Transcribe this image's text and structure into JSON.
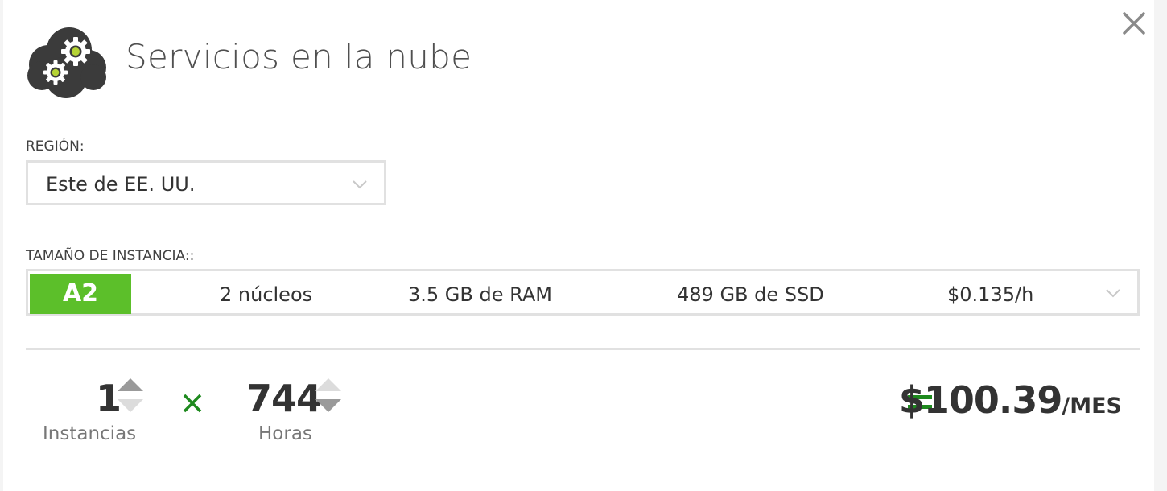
{
  "header": {
    "title": "Servicios en la nube",
    "logo_icon": "cloud-gears-icon",
    "close_icon": "close-icon"
  },
  "region": {
    "label": "REGIÓN:",
    "selected": "Este de EE. UU."
  },
  "instance_size": {
    "label": "TAMAÑO DE INSTANCIA::",
    "selected": {
      "tier": "A2",
      "cores": "2 núcleos",
      "ram": "3.5 GB de RAM",
      "storage": "489 GB de SSD",
      "price": "$0.135/h"
    }
  },
  "calculator": {
    "instances": {
      "value": "1",
      "label": "Instancias"
    },
    "hours": {
      "value": "744",
      "label": "Horas"
    },
    "total": {
      "amount": "$100.39",
      "unit": "/MES"
    }
  },
  "colors": {
    "accent_green": "#5cbf2a",
    "operator_green": "#1e8a1e",
    "text_dark": "#333333",
    "border": "#e1e1e1"
  }
}
